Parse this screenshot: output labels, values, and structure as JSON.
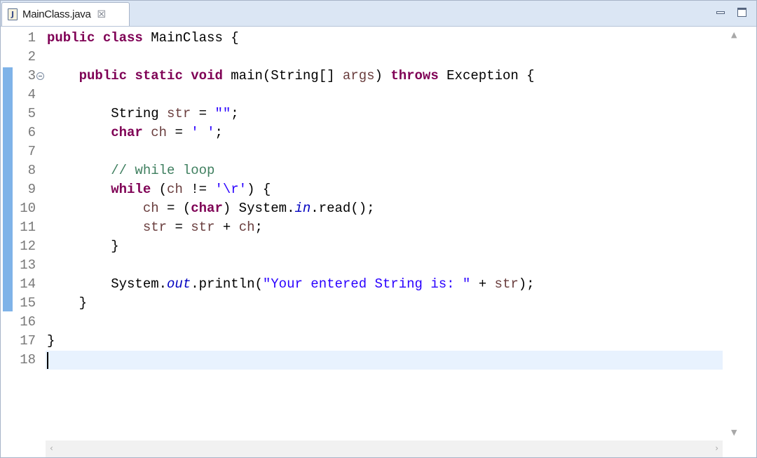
{
  "tab": {
    "title": "MainClass.java",
    "file_icon": "java-file-icon",
    "file_icon_glyph": "J",
    "close_glyph": "☒"
  },
  "window_controls": {
    "minimize": "minimize-icon",
    "maximize": "maximize-icon"
  },
  "editor": {
    "line_numbers": [
      "1",
      "2",
      "3",
      "4",
      "5",
      "6",
      "7",
      "8",
      "9",
      "10",
      "11",
      "12",
      "13",
      "14",
      "15",
      "16",
      "17",
      "18"
    ],
    "folded_line": "3",
    "current_line": "18",
    "code": [
      [
        [
          "kw",
          "public"
        ],
        [
          "p",
          " "
        ],
        [
          "kw",
          "class"
        ],
        [
          "p",
          " MainClass {"
        ]
      ],
      [],
      [
        [
          "p",
          "    "
        ],
        [
          "kw",
          "public"
        ],
        [
          "p",
          " "
        ],
        [
          "kw",
          "static"
        ],
        [
          "p",
          " "
        ],
        [
          "kw",
          "void"
        ],
        [
          "p",
          " main(String[] "
        ],
        [
          "var",
          "args"
        ],
        [
          "p",
          ") "
        ],
        [
          "kw",
          "throws"
        ],
        [
          "p",
          " Exception {"
        ]
      ],
      [],
      [
        [
          "p",
          "        String "
        ],
        [
          "var",
          "str"
        ],
        [
          "p",
          " = "
        ],
        [
          "str",
          "\"\""
        ],
        [
          "p",
          ";"
        ]
      ],
      [
        [
          "p",
          "        "
        ],
        [
          "kw",
          "char"
        ],
        [
          "p",
          " "
        ],
        [
          "var",
          "ch"
        ],
        [
          "p",
          " = "
        ],
        [
          "str",
          "' '"
        ],
        [
          "p",
          ";"
        ]
      ],
      [],
      [
        [
          "p",
          "        "
        ],
        [
          "cmt",
          "// while loop"
        ]
      ],
      [
        [
          "p",
          "        "
        ],
        [
          "kw",
          "while"
        ],
        [
          "p",
          " ("
        ],
        [
          "var",
          "ch"
        ],
        [
          "p",
          " != "
        ],
        [
          "str",
          "'\\r'"
        ],
        [
          "p",
          ") {"
        ]
      ],
      [
        [
          "p",
          "            "
        ],
        [
          "var",
          "ch"
        ],
        [
          "p",
          " = ("
        ],
        [
          "kw",
          "char"
        ],
        [
          "p",
          ") System."
        ],
        [
          "fld",
          "in"
        ],
        [
          "p",
          ".read();"
        ]
      ],
      [
        [
          "p",
          "            "
        ],
        [
          "var",
          "str"
        ],
        [
          "p",
          " = "
        ],
        [
          "var",
          "str"
        ],
        [
          "p",
          " + "
        ],
        [
          "var",
          "ch"
        ],
        [
          "p",
          ";"
        ]
      ],
      [
        [
          "p",
          "        }"
        ]
      ],
      [],
      [
        [
          "p",
          "        System."
        ],
        [
          "fld",
          "out"
        ],
        [
          "p",
          ".println("
        ],
        [
          "str",
          "\"Your entered String is: \""
        ],
        [
          "p",
          " + "
        ],
        [
          "var",
          "str"
        ],
        [
          "p",
          ");"
        ]
      ],
      [
        [
          "p",
          "    }"
        ]
      ],
      [],
      [
        [
          "p",
          "}"
        ]
      ],
      []
    ]
  },
  "colors": {
    "keyword": "#7f0055",
    "local_variable": "#6a3e3e",
    "string": "#2a00ff",
    "comment": "#3f7f5f",
    "static_field": "#0000c0",
    "current_line_highlight": "#e8f2fe",
    "change_bar": "#7fb3e8"
  },
  "scrollbars": {
    "up": "▲",
    "down": "▼",
    "left": "‹",
    "right": "›"
  }
}
